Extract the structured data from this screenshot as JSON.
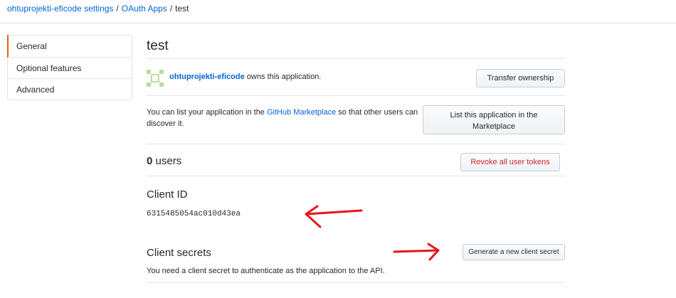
{
  "breadcrumb": {
    "org_settings": "ohtuprojekti-eficode settings",
    "separator": "/",
    "oauth_apps": "OAuth Apps",
    "current": "test"
  },
  "sidebar": {
    "items": [
      {
        "label": "General",
        "active": true
      },
      {
        "label": "Optional features",
        "active": false
      },
      {
        "label": "Advanced",
        "active": false
      }
    ]
  },
  "app": {
    "title": "test",
    "owner": {
      "name": "ohtuprojekti-eficode",
      "suffix": "owns this application.",
      "transfer_button": "Transfer ownership"
    },
    "marketplace": {
      "text_before": "You can list your application in the",
      "link": "GitHub Marketplace",
      "text_after": "so that other users can discover it.",
      "button_line1": "List this application in the",
      "button_line2": "Marketplace"
    },
    "users": {
      "count": "0",
      "label": "users",
      "revoke_button": "Revoke all user tokens"
    },
    "client_id": {
      "heading": "Client ID",
      "value": "6315485054ac010d43ea"
    },
    "client_secrets": {
      "heading": "Client secrets",
      "generate_button": "Generate a new client secret",
      "description": "You need a client secret to authenticate as the application to the API."
    }
  },
  "colors": {
    "link": "#0366d6",
    "danger": "#cb2431",
    "active_indicator": "#e36209",
    "annotation_arrow": "#e8141c",
    "avatar": "#b7dd9f"
  }
}
